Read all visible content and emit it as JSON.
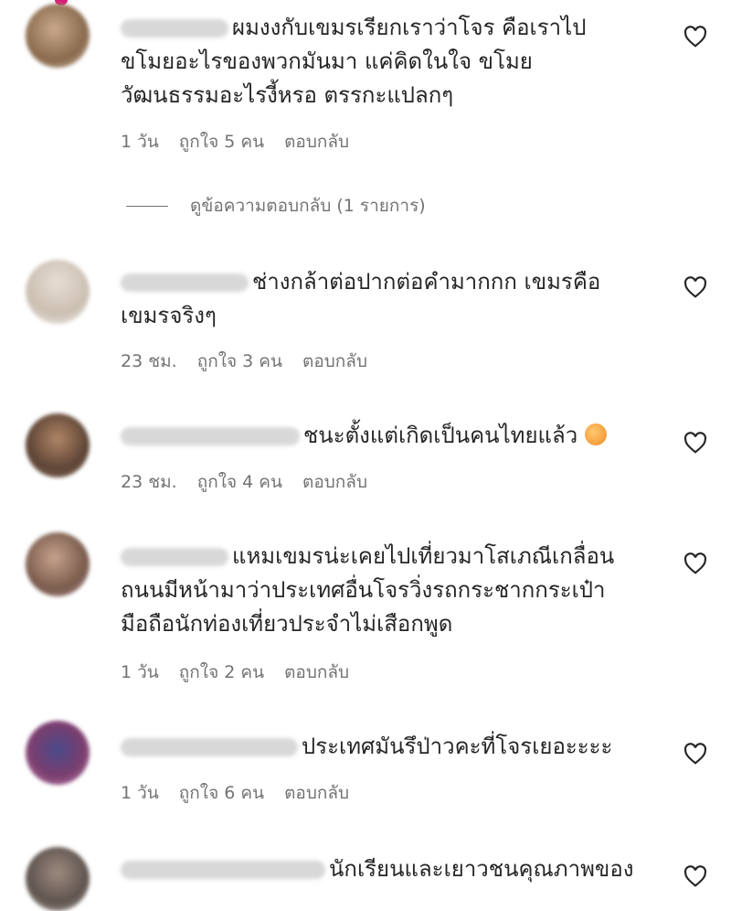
{
  "colors": {
    "text": "#262626",
    "meta": "#737373",
    "badge": "#e0197d"
  },
  "view_replies_label": "ดูข้อความตอบกลับ (1 รายการ)",
  "comments": [
    {
      "text": "ผมงงกับเขมรเรียกเราว่าโจร คือเราไป\nขโมยอะไรของพวกมันมา แค่คิดในใจ ขโมย\nวัฒนธรรมอะไรงี้หรอ ตรรกะแปลกๆ",
      "time": "1 วัน",
      "likes": "ถูกใจ 5 คน",
      "reply": "ตอบกลับ",
      "heart_icon": "heart-outline-icon"
    },
    {
      "text": "ช่างกล้าต่อปากต่อคำมากกก เขมรคือ\nเขมรจริงๆ",
      "time": "23 ชม.",
      "likes": "ถูกใจ 3 คน",
      "reply": "ตอบกลับ",
      "heart_icon": "heart-outline-icon"
    },
    {
      "text": "ชนะตั้งแต่เกิดเป็นคนไทยแล้ว",
      "time": "23 ชม.",
      "likes": "ถูกใจ 4 คน",
      "reply": "ตอบกลับ",
      "heart_icon": "heart-outline-icon",
      "emoji": "laughing-emoji-icon"
    },
    {
      "text": "แหมเขมรน่ะเคยไปเที่ยวมาโสเภณีเกลื่อน\nถนนมีหน้ามาว่าประเทศอื่นโจรวิ่งรถกระชากกระเป๋า\nมือถือนักท่องเที่ยวประจำไม่เสือกพูด",
      "time": "1 วัน",
      "likes": "ถูกใจ 2 คน",
      "reply": "ตอบกลับ",
      "heart_icon": "heart-outline-icon"
    },
    {
      "text": "ประเทศมันรึป่าวคะที่โจรเยอะะะะ",
      "time": "1 วัน",
      "likes": "ถูกใจ 6 คน",
      "reply": "ตอบกลับ",
      "heart_icon": "heart-outline-icon"
    },
    {
      "text": "นักเรียนและเยาวชนคุณภาพของ",
      "heart_icon": "heart-outline-icon"
    }
  ]
}
